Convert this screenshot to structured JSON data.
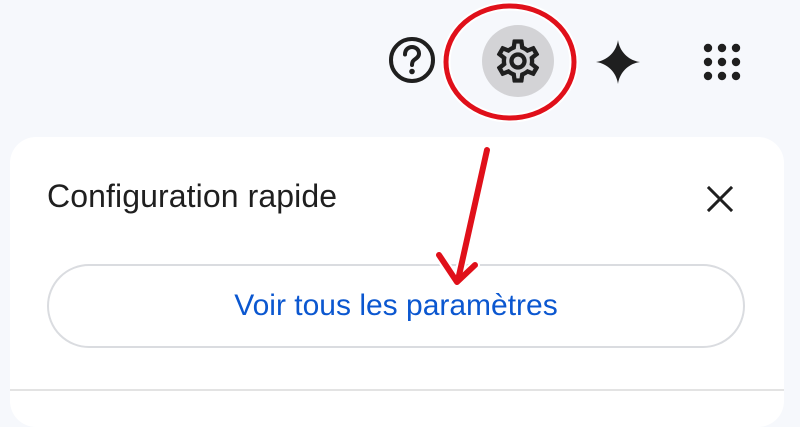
{
  "header": {
    "icons": {
      "help": "help-circle-icon",
      "settings": "gear-icon",
      "gemini": "sparkle-icon",
      "apps": "apps-grid-icon"
    }
  },
  "quick_settings": {
    "title": "Configuration rapide",
    "view_all_label": "Voir tous les paramètres",
    "close_icon": "close-icon"
  },
  "colors": {
    "page_background": "#f6f8fc",
    "panel_background": "#ffffff",
    "link_blue": "#0b57d0",
    "annotation_red": "#e0101a",
    "settings_highlight": "#d3d3d6"
  }
}
